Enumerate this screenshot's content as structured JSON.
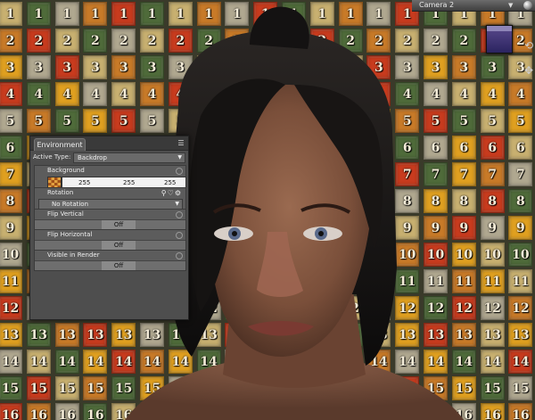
{
  "viewport": {
    "camera": {
      "label": "Camera 2",
      "arrow": "▼"
    },
    "backdrop_grid": {
      "columns": 19,
      "rows": [
        {
          "number": "1",
          "colors": [
            "#c8b070",
            "#4f6b3a",
            "#b0a890",
            "#c87a28",
            "#c83b1e",
            "#4f6b3a",
            "#c8b070",
            "#c87a28",
            "#b0a890",
            "#c83b1e",
            "#4f6b3a",
            "#c8b070",
            "#c87a28",
            "#b0a890",
            "#c83b1e",
            "#4f6b3a",
            "#c8b070",
            "#c87a28",
            "#b0a890"
          ]
        },
        {
          "number": "2",
          "colors": [
            "#c87a28",
            "#c83b1e",
            "#c8b070",
            "#4f6b3a",
            "#b0a890",
            "#c8b070",
            "#c83b1e",
            "#4f6b3a",
            "#c87a28",
            "#c8b070",
            "#b0a890",
            "#c83b1e",
            "#4f6b3a",
            "#c87a28",
            "#c8b070",
            "#b0a890",
            "#4f6b3a",
            "#c83b1e",
            "#c87a28"
          ]
        },
        {
          "number": "3",
          "colors": [
            "#e0a020",
            "#b0a890",
            "#c83b1e",
            "#c8b070",
            "#c87a28",
            "#4f6b3a",
            "#b0a890",
            "#c8b070",
            "#c83b1e",
            "#e0a020",
            "#c87a28",
            "#4f6b3a",
            "#c8b070",
            "#c83b1e",
            "#b0a890",
            "#e0a020",
            "#c87a28",
            "#4f6b3a",
            "#c8b070"
          ]
        },
        {
          "number": "4",
          "colors": [
            "#c83b1e",
            "#4f6b3a",
            "#e0a020",
            "#b0a890",
            "#c8b070",
            "#c87a28",
            "#c83b1e",
            "#e0a020",
            "#4f6b3a",
            "#b0a890",
            "#c8b070",
            "#c87a28",
            "#e0a020",
            "#c83b1e",
            "#4f6b3a",
            "#b0a890",
            "#c8b070",
            "#e0a020",
            "#c87a28"
          ]
        },
        {
          "number": "5",
          "colors": [
            "#b0a890",
            "#c87a28",
            "#4f6b3a",
            "#e0a020",
            "#c83b1e",
            "#b0a890",
            "#c8b070",
            "#c87a28",
            "#e0a020",
            "#4f6b3a",
            "#c83b1e",
            "#c8b070",
            "#b0a890",
            "#e0a020",
            "#c87a28",
            "#c83b1e",
            "#4f6b3a",
            "#c8b070",
            "#e0a020"
          ]
        },
        {
          "number": "6",
          "colors": [
            "#4f6b3a",
            "#e0a020",
            "#c87a28",
            "#c83b1e",
            "#b0a890",
            "#c8b070",
            "#e0a020",
            "#4f6b3a",
            "#c87a28",
            "#c83b1e",
            "#b0a890",
            "#e0a020",
            "#c8b070",
            "#c87a28",
            "#4f6b3a",
            "#b0a890",
            "#e0a020",
            "#c83b1e",
            "#c8b070"
          ]
        },
        {
          "number": "7",
          "colors": [
            "#e0a020",
            "#c8b070",
            "#c83b1e",
            "#4f6b3a",
            "#c87a28",
            "#e0a020",
            "#b0a890",
            "#c83b1e",
            "#c8b070",
            "#4f6b3a",
            "#e0a020",
            "#c87a28",
            "#b0a890",
            "#c8b070",
            "#c83b1e",
            "#4f6b3a",
            "#e0a020",
            "#c87a28",
            "#b0a890"
          ]
        },
        {
          "number": "8",
          "colors": [
            "#c87a28",
            "#c83b1e",
            "#b0a890",
            "#c8b070",
            "#e0a020",
            "#4f6b3a",
            "#c87a28",
            "#b0a890",
            "#c83b1e",
            "#e0a020",
            "#c8b070",
            "#4f6b3a",
            "#c87a28",
            "#c83b1e",
            "#b0a890",
            "#e0a020",
            "#c8b070",
            "#c83b1e",
            "#4f6b3a"
          ]
        },
        {
          "number": "9",
          "colors": [
            "#c8b070",
            "#e0a020",
            "#4f6b3a",
            "#c87a28",
            "#c83b1e",
            "#b0a890",
            "#e0a020",
            "#c8b070",
            "#4f6b3a",
            "#c87a28",
            "#b0a890",
            "#c83b1e",
            "#e0a020",
            "#4f6b3a",
            "#c8b070",
            "#c87a28",
            "#c83b1e",
            "#b0a890",
            "#e0a020"
          ]
        },
        {
          "number": "10",
          "colors": [
            "#b0a890",
            "#4f6b3a",
            "#e0a020",
            "#c83b1e",
            "#c8b070",
            "#c87a28",
            "#4f6b3a",
            "#e0a020",
            "#b0a890",
            "#c83b1e",
            "#c8b070",
            "#e0a020",
            "#4f6b3a",
            "#b0a890",
            "#c87a28",
            "#c83b1e",
            "#e0a020",
            "#c8b070",
            "#4f6b3a"
          ]
        },
        {
          "number": "11",
          "colors": [
            "#e0a020",
            "#c87a28",
            "#c8b070",
            "#4f6b3a",
            "#b0a890",
            "#e0a020",
            "#c83b1e",
            "#c87a28",
            "#e0a020",
            "#4f6b3a",
            "#b0a890",
            "#c8b070",
            "#c83b1e",
            "#e0a020",
            "#4f6b3a",
            "#b0a890",
            "#c87a28",
            "#e0a020",
            "#c8b070"
          ]
        },
        {
          "number": "12",
          "colors": [
            "#c83b1e",
            "#b0a890",
            "#4f6b3a",
            "#e0a020",
            "#c87a28",
            "#c83b1e",
            "#c8b070",
            "#b0a890",
            "#4f6b3a",
            "#e0a020",
            "#c83b1e",
            "#c87a28",
            "#c8b070",
            "#b0a890",
            "#e0a020",
            "#4f6b3a",
            "#c83b1e",
            "#b0a890",
            "#c87a28"
          ]
        },
        {
          "number": "13",
          "colors": [
            "#e0a020",
            "#4f6b3a",
            "#c87a28",
            "#c83b1e",
            "#e0a020",
            "#b0a890",
            "#4f6b3a",
            "#c8b070",
            "#c83b1e",
            "#e0a020",
            "#c87a28",
            "#b0a890",
            "#4f6b3a",
            "#c8b070",
            "#e0a020",
            "#c83b1e",
            "#c87a28",
            "#c8b070",
            "#e0a020"
          ]
        },
        {
          "number": "14",
          "colors": [
            "#b0a890",
            "#c8b070",
            "#4f6b3a",
            "#e0a020",
            "#c83b1e",
            "#c87a28",
            "#e0a020",
            "#4f6b3a",
            "#b0a890",
            "#c8b070",
            "#e0a020",
            "#c83b1e",
            "#4f6b3a",
            "#c87a28",
            "#b0a890",
            "#e0a020",
            "#4f6b3a",
            "#c8b070",
            "#c83b1e"
          ]
        },
        {
          "number": "15",
          "colors": [
            "#4f6b3a",
            "#c83b1e",
            "#c8b070",
            "#c87a28",
            "#4f6b3a",
            "#e0a020",
            "#b0a890",
            "#c83b1e",
            "#e0a020",
            "#c87a28",
            "#4f6b3a",
            "#c8b070",
            "#e0a020",
            "#b0a890",
            "#c83b1e",
            "#c87a28",
            "#e0a020",
            "#4f6b3a",
            "#b0a890"
          ]
        },
        {
          "number": "16",
          "colors": [
            "#c83b1e",
            "#c87a28",
            "#b0a890",
            "#4f6b3a",
            "#c8b070",
            "#c83b1e",
            "#e0a020",
            "#c87a28",
            "#4f6b3a",
            "#b0a890",
            "#c83b1e",
            "#e0a020",
            "#c8b070",
            "#c87a28",
            "#4f6b3a",
            "#c83b1e",
            "#b0a890",
            "#e0a020",
            "#c87a28"
          ]
        }
      ]
    }
  },
  "environment_panel": {
    "tab_label": "Environment",
    "options_icon": "panel-options-icon",
    "active_type": {
      "label": "Active Type:",
      "value": "Backdrop"
    },
    "background": {
      "title": "Background",
      "swatch_icon": "checker-swatch-icon",
      "r": "255",
      "g": "255",
      "b": "255"
    },
    "rotation": {
      "title": "Rotation",
      "value": "No Rotation",
      "icons": [
        "link-icon",
        "heart-icon",
        "gear-icon"
      ]
    },
    "flip_vertical": {
      "title": "Flip Vertical",
      "value": "Off"
    },
    "flip_horizontal": {
      "title": "Flip Horizontal",
      "value": "Off"
    },
    "visible_in_render": {
      "title": "Visible in Render",
      "value": "Off"
    }
  }
}
